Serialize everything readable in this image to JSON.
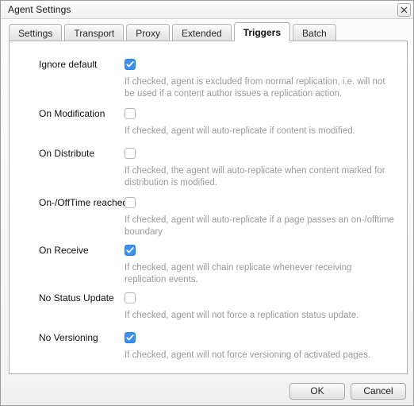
{
  "window": {
    "title": "Agent Settings",
    "close_icon": "close-icon"
  },
  "tabs": [
    {
      "label": "Settings",
      "active": false
    },
    {
      "label": "Transport",
      "active": false
    },
    {
      "label": "Proxy",
      "active": false
    },
    {
      "label": "Extended",
      "active": false
    },
    {
      "label": "Triggers",
      "active": true
    },
    {
      "label": "Batch",
      "active": false
    }
  ],
  "colors": {
    "checkbox_checked": "#3c90f0",
    "checkbox_border": "#b9b9b9",
    "description_text": "#9a9a9a",
    "label_text": "#111111"
  },
  "rows": [
    {
      "label": "Ignore default",
      "checked": true,
      "description": "If checked, agent is excluded from normal replication, i.e. will not be used if a content author issues a replication action."
    },
    {
      "label": "On Modification",
      "checked": false,
      "description": "If checked, agent will auto-replicate if content is modified."
    },
    {
      "label": "On Distribute",
      "checked": false,
      "description": "If checked, the agent will auto-replicate when content marked for distribution is modified."
    },
    {
      "label": "On-/OffTime reached",
      "checked": false,
      "description": "If checked, agent will auto-replicate if a page passes an on-/offtime boundary"
    },
    {
      "label": "On Receive",
      "checked": true,
      "description": "If checked, agent will chain replicate whenever receiving replication events."
    },
    {
      "label": "No Status Update",
      "checked": false,
      "description": "If checked, agent will not force a replication status update."
    },
    {
      "label": "No Versioning",
      "checked": true,
      "description": "If checked, agent will not force versioning of activated pages."
    }
  ],
  "footer": {
    "ok_label": "OK",
    "cancel_label": "Cancel"
  }
}
